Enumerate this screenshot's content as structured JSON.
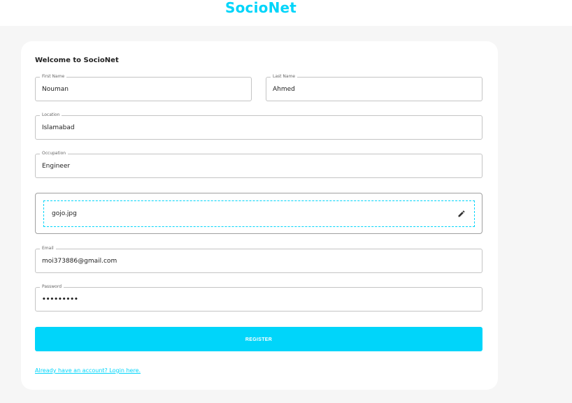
{
  "header": {
    "brand": "SocioNet"
  },
  "form": {
    "welcome": "Welcome to SocioNet",
    "first_name": {
      "label": "First Name",
      "value": "Nouman"
    },
    "last_name": {
      "label": "Last Name",
      "value": "Ahmed"
    },
    "location": {
      "label": "Location",
      "value": "Islamabad"
    },
    "occupation": {
      "label": "Occupation",
      "value": "Engineer"
    },
    "picture": {
      "file_name": "gojo.jpg",
      "icon": "pencil-icon"
    },
    "email": {
      "label": "Email",
      "value": "moi373886@gmail.com"
    },
    "password": {
      "label": "Password",
      "value": "•••••••••"
    },
    "register_label": "REGISTER",
    "login_link": "Already have an account? Login here."
  },
  "colors": {
    "accent": "#00d5fa",
    "background": "#f6f6f6",
    "card": "#ffffff"
  }
}
